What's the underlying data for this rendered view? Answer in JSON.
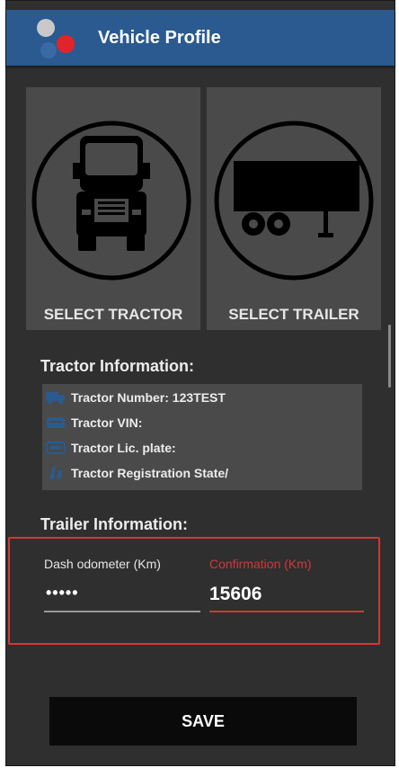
{
  "app_bar": {
    "title": "Vehicle Profile"
  },
  "tiles": {
    "tractor_label": "SELECT TRACTOR",
    "trailer_label": "SELECT TRAILER"
  },
  "tractor_info": {
    "heading": "Tractor Information:",
    "rows": [
      {
        "icon": "truck-icon",
        "text": "Tractor Number: 123TEST"
      },
      {
        "icon": "vin-card-icon",
        "text": "Tractor VIN:"
      },
      {
        "icon": "license-plate-icon",
        "text": "Tractor Lic. plate:"
      },
      {
        "icon": "registration-state-icon",
        "text": "Tractor Registration State/"
      }
    ]
  },
  "trailer_info": {
    "heading": "Trailer Information:"
  },
  "odometer": {
    "dash_label": "Dash odometer (Km)",
    "dash_value": "•••••",
    "confirm_label": "Confirmation (Km)",
    "confirm_value": "15606"
  },
  "save_label": "SAVE",
  "colors": {
    "app_bar": "#2a5a8f",
    "error_red": "#d63636",
    "background": "#2f2f2f",
    "tile": "#4a4a4a"
  }
}
